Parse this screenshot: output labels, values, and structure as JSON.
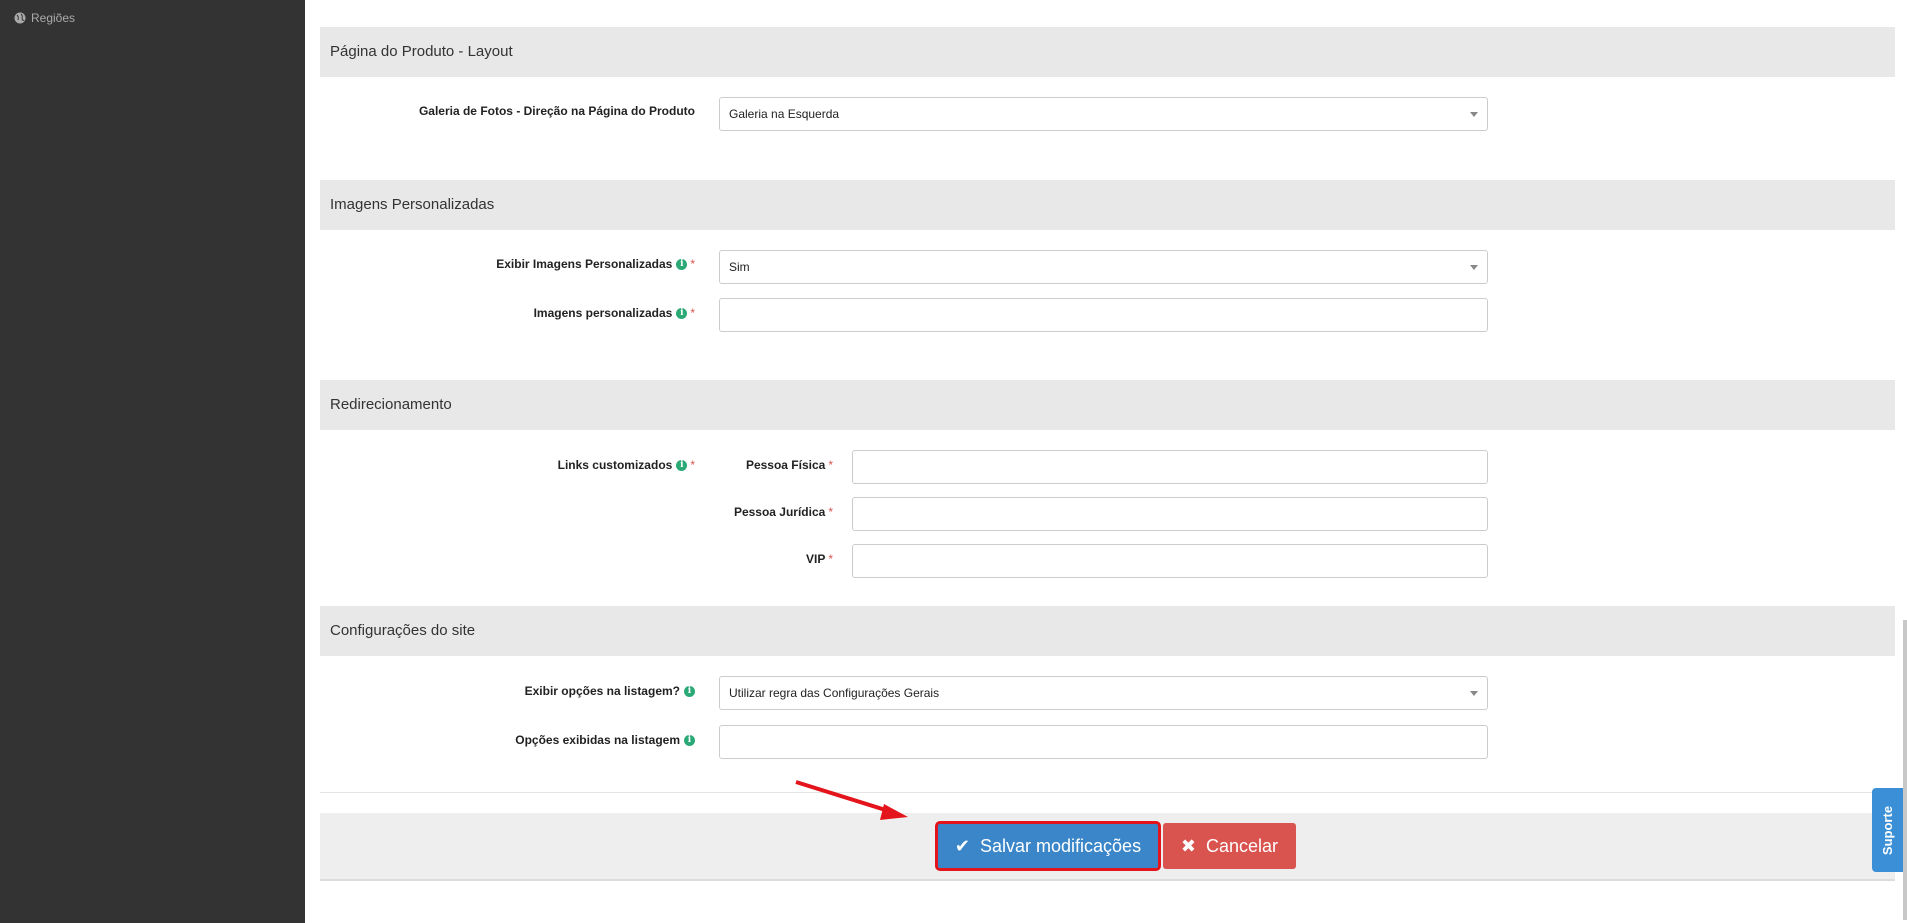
{
  "sidebar": {
    "items": [
      {
        "label": "Regiões",
        "icon": "globe-icon"
      }
    ]
  },
  "sections": {
    "product_layout": {
      "title": "Página do Produto - Layout",
      "gallery_label": "Galeria de Fotos - Direção na Página do Produto",
      "gallery_value": "Galeria na Esquerda"
    },
    "custom_images": {
      "title": "Imagens Personalizadas",
      "show_label": "Exibir Imagens Personalizadas",
      "show_value": "Sim",
      "images_label": "Imagens personalizadas",
      "images_value": ""
    },
    "redirect": {
      "title": "Redirecionamento",
      "links_label": "Links customizados",
      "pf_label": "Pessoa Física",
      "pj_label": "Pessoa Jurídica",
      "vip_label": "VIP",
      "pf_value": "",
      "pj_value": "",
      "vip_value": ""
    },
    "site_config": {
      "title": "Configurações do site",
      "show_options_label": "Exibir opções na listagem?",
      "show_options_value": "Utilizar regra das Configurações Gerais",
      "options_shown_label": "Opções exibidas na listagem",
      "options_shown_value": ""
    }
  },
  "footer": {
    "save_label": "Salvar modificações",
    "cancel_label": "Cancelar"
  },
  "support_tab": {
    "label": "Suporte"
  },
  "colors": {
    "sidebar_bg": "#333333",
    "primary": "#3a86c8",
    "danger": "#d9534f",
    "highlight": "#e3141b",
    "info": "#2aa876"
  }
}
